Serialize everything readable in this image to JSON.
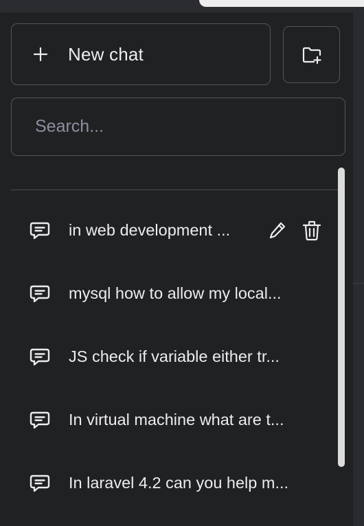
{
  "sidebar": {
    "new_chat_label": "New chat",
    "search_placeholder": "Search...",
    "conversations": [
      {
        "title": "in web development ...",
        "selected": true
      },
      {
        "title": "mysql how to allow my local..."
      },
      {
        "title": "JS check if variable either tr..."
      },
      {
        "title": "In virtual machine what are t..."
      },
      {
        "title": "In laravel 4.2 can you help m..."
      }
    ]
  },
  "icons": {
    "new_chat": "plus-icon",
    "new_folder": "folder-plus-icon",
    "conversation": "chat-bubble-icon",
    "edit": "pencil-icon",
    "delete": "trash-icon"
  },
  "colors": {
    "background": "#202123",
    "text": "#ececf1",
    "border": "#545559",
    "placeholder": "#8e8ea0"
  }
}
